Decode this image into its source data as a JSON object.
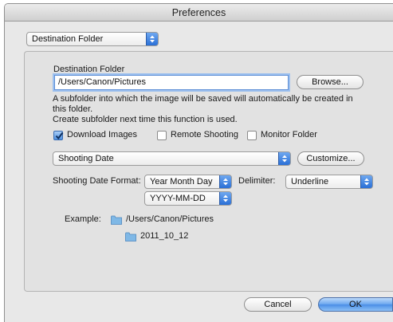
{
  "window": {
    "title": "Preferences"
  },
  "category_popup": {
    "selected": "Destination Folder"
  },
  "destination": {
    "label": "Destination Folder",
    "path_value": "/Users/Canon/Pictures",
    "browse_label": "Browse..."
  },
  "description": {
    "line1": "A subfolder into which the image will be saved will automatically be created in",
    "line2": "this folder.",
    "line3": "Create subfolder next time this function is used."
  },
  "options": {
    "download_images": {
      "label": "Download Images",
      "checked": true
    },
    "remote_shooting": {
      "label": "Remote Shooting",
      "checked": false
    },
    "monitor_folder": {
      "label": "Monitor Folder",
      "checked": false
    }
  },
  "subfolder_popup": {
    "selected": "Shooting Date",
    "customize_label": "Customize..."
  },
  "date_format": {
    "label": "Shooting Date Format:",
    "order_selected": "Year Month Day",
    "pattern_selected": "YYYY-MM-DD",
    "delimiter_label": "Delimiter:",
    "delimiter_selected": "Underline"
  },
  "example": {
    "label": "Example:",
    "folder_path": "/Users/Canon/Pictures",
    "subfolder_name": "2011_10_12"
  },
  "footer": {
    "cancel_label": "Cancel",
    "ok_label": "OK"
  },
  "colors": {
    "accent": "#4a8ee6",
    "panel": "#e2e2e2",
    "window": "#e8e8e8",
    "folder": "#7fb8e6"
  },
  "icons": [
    "chevron-updown-icon",
    "checkmark-icon",
    "folder-icon"
  ]
}
